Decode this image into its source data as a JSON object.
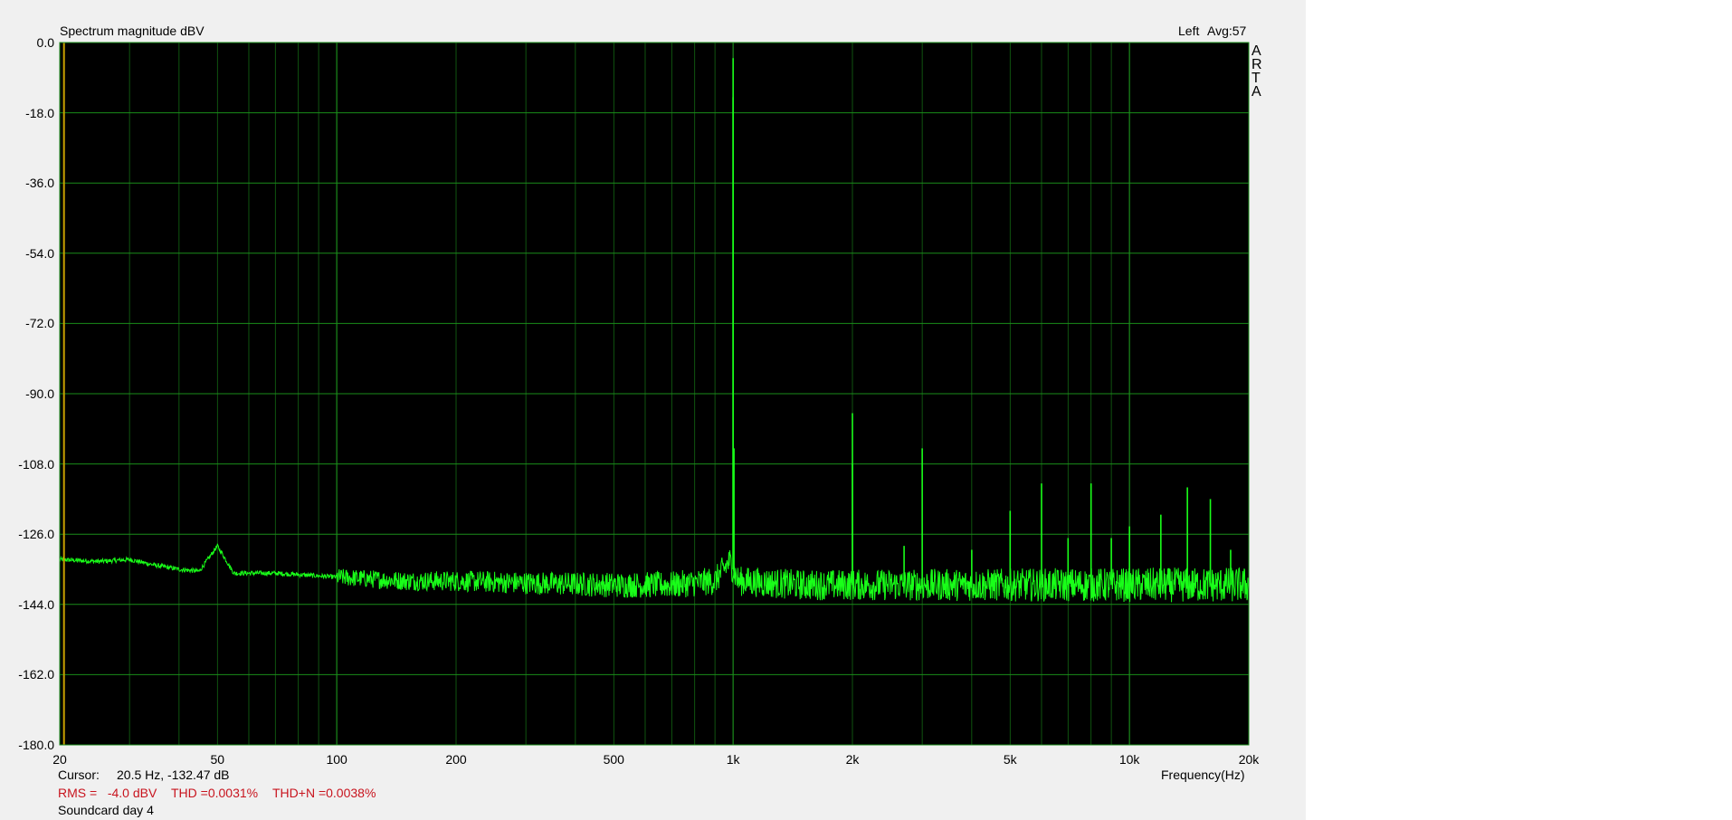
{
  "header": {
    "title": "Spectrum magnitude dBV",
    "channel": "Left",
    "avg": "Avg:57"
  },
  "watermark": [
    "A",
    "R",
    "T",
    "A"
  ],
  "footer": {
    "cursor_label": "Cursor:",
    "cursor_value": "20.5 Hz, -132.47 dB",
    "rms": "RMS =   -4.0 dBV",
    "thd": "THD =0.0031%",
    "thdn": "THD+N =0.0038%",
    "description": "Soundcard day 4"
  },
  "colors": {
    "plot_bg": "#000000",
    "grid": "#1a8c1a",
    "trace": "#19ff19",
    "cursor": "#c8a000",
    "stats": "#c8141e"
  },
  "chart_data": {
    "type": "line",
    "title": "Spectrum magnitude dBV",
    "xlabel": "Frequency(Hz)",
    "ylabel": "",
    "x_scale": "log",
    "xlim": [
      20,
      20000
    ],
    "ylim": [
      -180,
      0
    ],
    "grid": true,
    "x_ticks": [
      {
        "value": 20,
        "label": "20"
      },
      {
        "value": 50,
        "label": "50"
      },
      {
        "value": 100,
        "label": "100"
      },
      {
        "value": 200,
        "label": "200"
      },
      {
        "value": 500,
        "label": "500"
      },
      {
        "value": 1000,
        "label": "1k"
      },
      {
        "value": 2000,
        "label": "2k"
      },
      {
        "value": 5000,
        "label": "5k"
      },
      {
        "value": 10000,
        "label": "10k"
      },
      {
        "value": 20000,
        "label": "20k"
      }
    ],
    "y_ticks": [
      {
        "value": 0,
        "label": "0.0"
      },
      {
        "value": -18,
        "label": "-18.0"
      },
      {
        "value": -36,
        "label": "-36.0"
      },
      {
        "value": -54,
        "label": "-54.0"
      },
      {
        "value": -72,
        "label": "-72.0"
      },
      {
        "value": -90,
        "label": "-90.0"
      },
      {
        "value": -108,
        "label": "-108.0"
      },
      {
        "value": -126,
        "label": "-126.0"
      },
      {
        "value": -144,
        "label": "-144.0"
      },
      {
        "value": -162,
        "label": "-162.0"
      },
      {
        "value": -180,
        "label": "-180.0"
      }
    ],
    "cursor_x": 20.5,
    "noise_floor": [
      [
        20,
        -132.5
      ],
      [
        25,
        -133
      ],
      [
        30,
        -132.5
      ],
      [
        35,
        -134
      ],
      [
        40,
        -135
      ],
      [
        45,
        -135.5
      ],
      [
        50,
        -129
      ],
      [
        55,
        -136
      ],
      [
        70,
        -136
      ],
      [
        100,
        -137
      ],
      [
        150,
        -138
      ],
      [
        200,
        -138
      ],
      [
        300,
        -138.5
      ],
      [
        500,
        -139
      ],
      [
        700,
        -139
      ],
      [
        900,
        -138
      ],
      [
        980,
        -133
      ],
      [
        1030,
        -138
      ],
      [
        1500,
        -139
      ],
      [
        2000,
        -139
      ],
      [
        5000,
        -139
      ],
      [
        10000,
        -139
      ],
      [
        20000,
        -139
      ]
    ],
    "peaks": [
      {
        "x": 1000,
        "y": -4
      },
      {
        "x": 1000,
        "y": -14
      },
      {
        "x": 1005,
        "y": -104
      },
      {
        "x": 2000,
        "y": -95
      },
      {
        "x": 2000,
        "y": -108
      },
      {
        "x": 2700,
        "y": -129
      },
      {
        "x": 3000,
        "y": -104
      },
      {
        "x": 4000,
        "y": -130
      },
      {
        "x": 5000,
        "y": -120
      },
      {
        "x": 6000,
        "y": -113
      },
      {
        "x": 7000,
        "y": -127
      },
      {
        "x": 8000,
        "y": -113
      },
      {
        "x": 9000,
        "y": -127
      },
      {
        "x": 10000,
        "y": -124
      },
      {
        "x": 12000,
        "y": -121
      },
      {
        "x": 14000,
        "y": -114
      },
      {
        "x": 16000,
        "y": -117
      },
      {
        "x": 18000,
        "y": -130
      }
    ]
  }
}
